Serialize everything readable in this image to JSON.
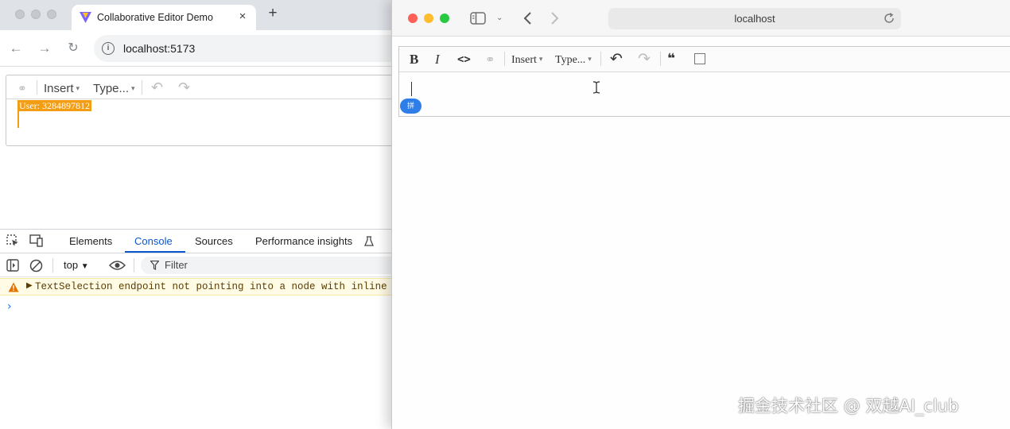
{
  "chrome": {
    "tab_title": "Collaborative Editor Demo",
    "tab_close": "×",
    "new_tab": "+",
    "url": "localhost:5173",
    "back_icon": "←",
    "forward_icon": "→",
    "reload_icon": "↻",
    "site_info_icon": "i"
  },
  "left_editor": {
    "link_icon": "⚭",
    "insert_label": "Insert",
    "type_label": "Type...",
    "undo_icon": "↶",
    "redo_icon": "↷",
    "caret_glyph": "▾",
    "remote_user_label": "User: 3284897812",
    "remote_cursor_color": "#f29d14"
  },
  "devtools": {
    "tabs": [
      "Elements",
      "Console",
      "Sources",
      "Performance insights"
    ],
    "active_tab": "Console",
    "context_select": "top",
    "filter_placeholder": "Filter",
    "warning_message": "TextSelection endpoint not pointing into a node with inline co",
    "prompt_symbol": "›"
  },
  "safari": {
    "url": "localhost",
    "traffic_colors": [
      "#fe5f57",
      "#febc2e",
      "#28c840"
    ]
  },
  "right_editor": {
    "bold": "B",
    "italic": "I",
    "code": "<>",
    "link_icon": "⚭",
    "insert_label": "Insert",
    "type_label": "Type...",
    "undo_icon": "↶",
    "redo_icon": "↷",
    "quote": "❝",
    "caret_glyph": "▾",
    "ime_badge": "拼"
  },
  "watermark": "掘金技术社区 @ 双越AI_club"
}
